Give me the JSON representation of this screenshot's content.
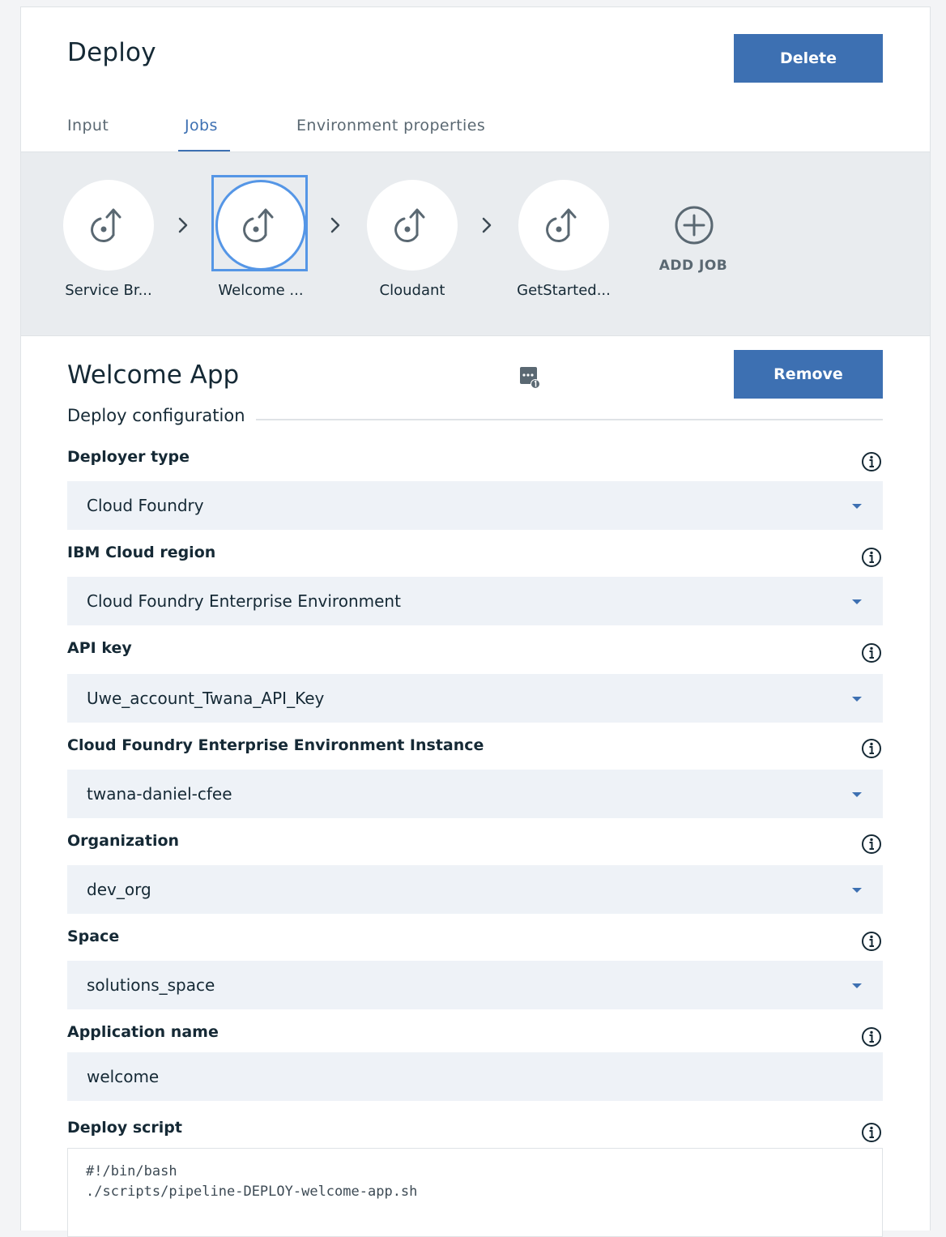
{
  "header": {
    "title": "Deploy",
    "delete_label": "Delete"
  },
  "tabs": [
    {
      "label": "Input",
      "active": false
    },
    {
      "label": "Jobs",
      "active": true
    },
    {
      "label": "Environment properties",
      "active": false
    }
  ],
  "jobs": [
    {
      "label": "Service Br...",
      "selected": false
    },
    {
      "label": "Welcome ...",
      "selected": true
    },
    {
      "label": "Cloudant",
      "selected": false
    },
    {
      "label": "GetStarted...",
      "selected": false
    }
  ],
  "add_job_label": "ADD JOB",
  "detail": {
    "title": "Welcome App",
    "remove_label": "Remove",
    "section_title": "Deploy configuration"
  },
  "fields": {
    "deployer_type": {
      "label": "Deployer type",
      "value": "Cloud Foundry"
    },
    "region": {
      "label": "IBM Cloud region",
      "value": "Cloud Foundry Enterprise Environment"
    },
    "api_key": {
      "label": "API key",
      "value": "Uwe_account_Twana_API_Key"
    },
    "cfee_instance": {
      "label": "Cloud Foundry Enterprise Environment Instance",
      "value": "twana-daniel-cfee"
    },
    "organization": {
      "label": "Organization",
      "value": "dev_org"
    },
    "space": {
      "label": "Space",
      "value": "solutions_space"
    },
    "app_name": {
      "label": "Application name",
      "value": "welcome"
    },
    "deploy_script": {
      "label": "Deploy script",
      "value": "#!/bin/bash\n./scripts/pipeline-DEPLOY-welcome-app.sh"
    }
  },
  "colors": {
    "accent": "#3d70b2",
    "selection": "#5596e6",
    "field_bg": "#eef2f7"
  },
  "icons": {
    "job": "deploy-job-icon",
    "chevron": "chevron-right-icon",
    "add": "plus-circle-icon",
    "info": "info-icon",
    "caret": "caret-down-icon",
    "console": "console-log-icon"
  }
}
